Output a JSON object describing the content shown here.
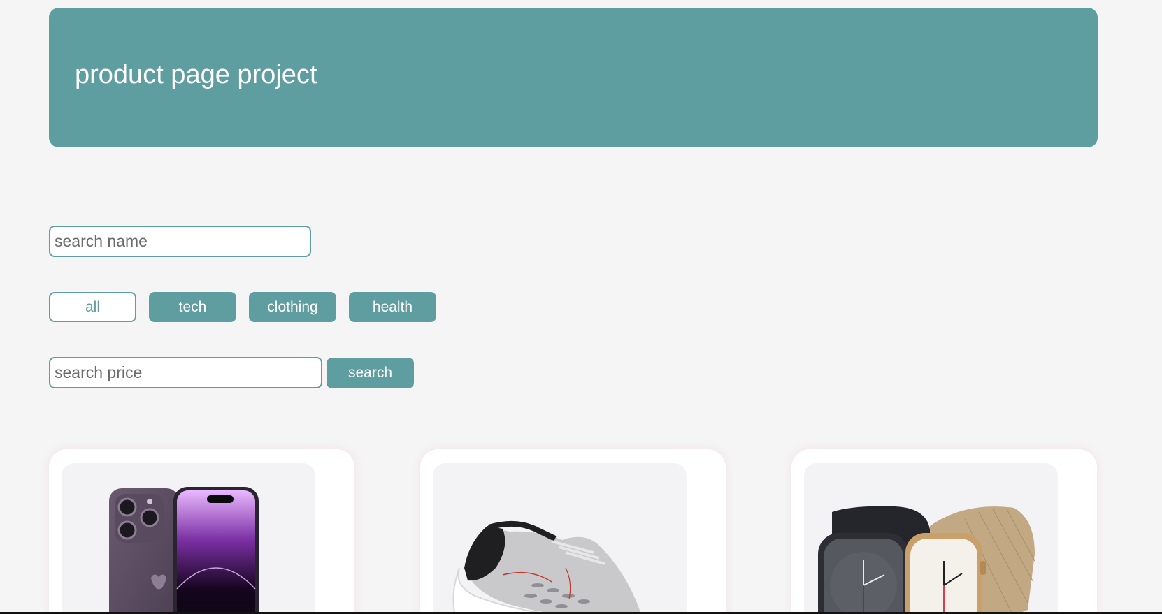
{
  "header": {
    "title": "product page project"
  },
  "search_name": {
    "placeholder": "search name"
  },
  "filters": [
    {
      "label": "all",
      "active": true
    },
    {
      "label": "tech",
      "active": false
    },
    {
      "label": "clothing",
      "active": false
    },
    {
      "label": "health",
      "active": false
    }
  ],
  "search_price": {
    "placeholder": "search price",
    "button_label": "search"
  },
  "products": [
    {
      "image": "phone-image"
    },
    {
      "image": "sneaker-image"
    },
    {
      "image": "watch-image"
    }
  ],
  "colors": {
    "accent": "#5f9ea0",
    "background": "#f5f5f5"
  }
}
